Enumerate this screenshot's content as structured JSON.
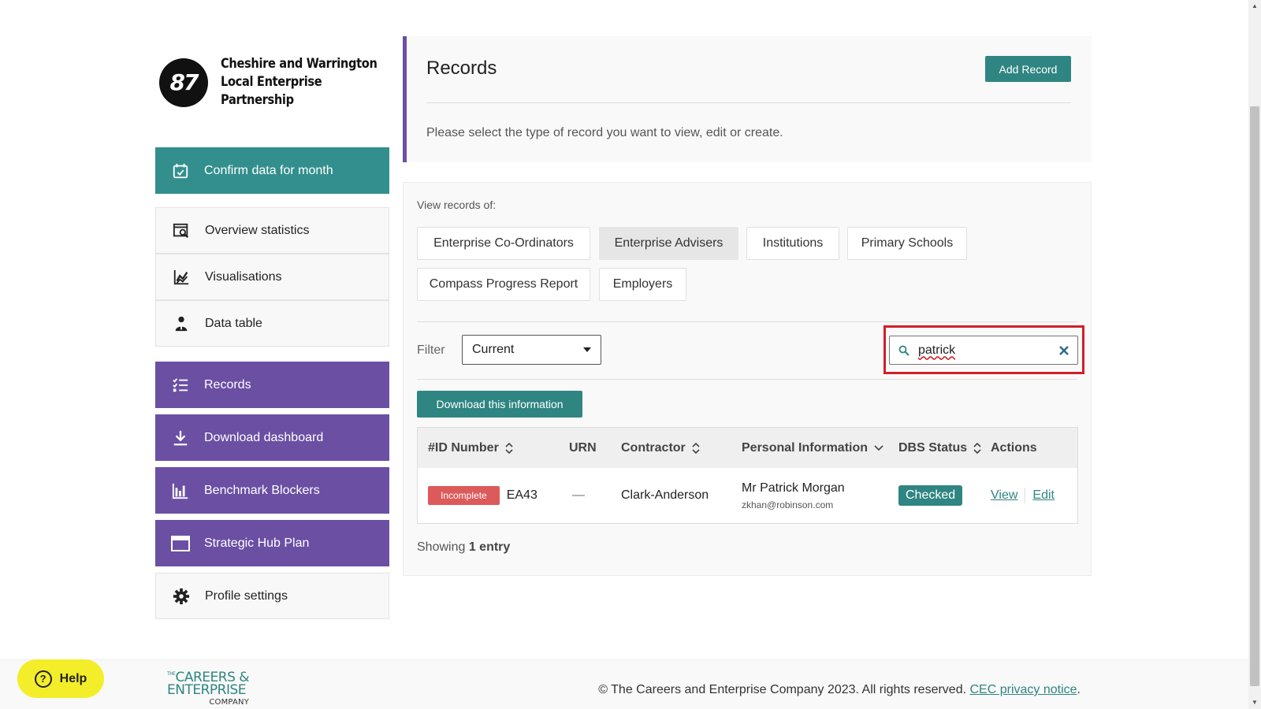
{
  "sidebar": {
    "logo_mark": "87",
    "logo_line1": "Cheshire and Warrington",
    "logo_line2": "Local Enterprise Partnership",
    "items": [
      {
        "label": "Confirm data for month",
        "icon": "calendar-check-icon"
      },
      {
        "label": "Overview statistics",
        "icon": "search-stats-icon"
      },
      {
        "label": "Visualisations",
        "icon": "chart-line-icon"
      },
      {
        "label": "Data table",
        "icon": "person-icon"
      },
      {
        "label": "Records",
        "icon": "list-icon"
      },
      {
        "label": "Download dashboard",
        "icon": "download-icon"
      },
      {
        "label": "Benchmark Blockers",
        "icon": "bar-chart-icon"
      },
      {
        "label": "Strategic Hub Plan",
        "icon": "window-icon"
      },
      {
        "label": "Profile settings",
        "icon": "gear-icon"
      }
    ]
  },
  "header": {
    "title": "Records",
    "add_label": "Add Record",
    "description": "Please select the type of record you want to view, edit or create."
  },
  "main": {
    "view_label": "View records of:",
    "categories": [
      {
        "label": "Enterprise Co-Ordinators"
      },
      {
        "label": "Enterprise Advisers",
        "active": true
      },
      {
        "label": "Institutions"
      },
      {
        "label": "Primary Schools"
      },
      {
        "label": "Compass Progress Report"
      },
      {
        "label": "Employers"
      }
    ],
    "filter_label": "Filter",
    "filter_value": "Current",
    "search_value": "patrick",
    "download_label": "Download this information",
    "table": {
      "headers": [
        "#ID Number",
        "URN",
        "Contractor",
        "Personal Information",
        "DBS Status",
        "Actions"
      ],
      "rows": [
        {
          "status": "Incomplete",
          "id": "EA43",
          "urn": "—",
          "contractor": "Clark-Anderson",
          "name": "Mr Patrick Morgan",
          "email": "zkhan@robinson.com",
          "dbs": "Checked",
          "view": "View",
          "edit": "Edit"
        }
      ]
    },
    "showing_prefix": "Showing",
    "showing_count": "1 entry"
  },
  "footer": {
    "help_label": "Help",
    "cec_the": "THE",
    "cec_line1": "CAREERS &",
    "cec_line2": "ENTERPRISE",
    "cec_line3": "COMPANY",
    "copyright": "© The Careers and Enterprise Company 2023. All rights reserved.",
    "privacy_link": "CEC privacy notice",
    "period": "."
  },
  "colors": {
    "teal": "#338f8d",
    "purple": "#6b4fa3",
    "danger": "#dd5a5a",
    "highlight": "#d0202b",
    "help": "#f4ee2a"
  }
}
